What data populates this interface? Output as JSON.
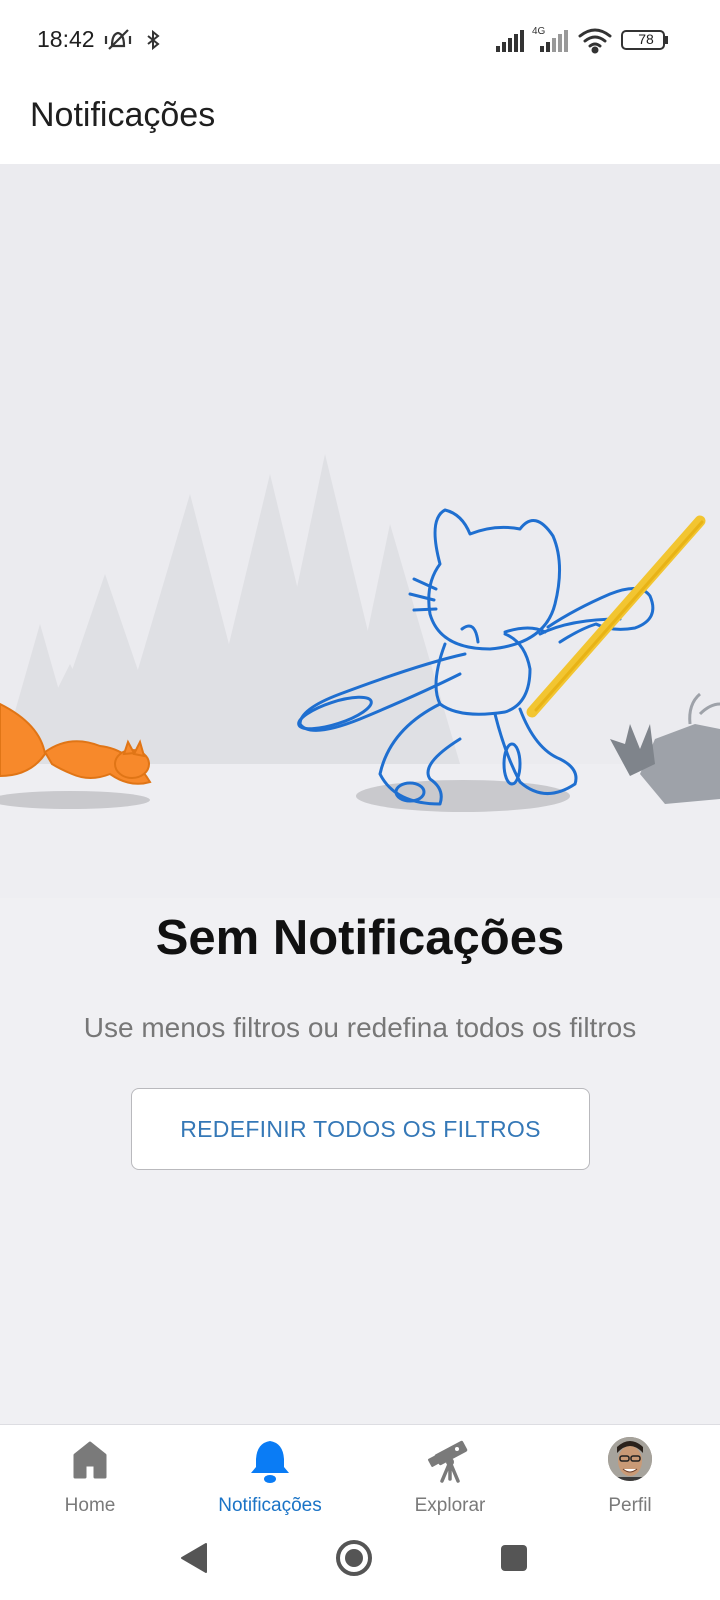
{
  "status_bar": {
    "time": "18:42",
    "battery": "78",
    "network": "4G"
  },
  "header": {
    "title": "Notificações"
  },
  "empty_state": {
    "title": "Sem Notificações",
    "subtitle": "Use menos filtros ou redefina todos os filtros",
    "reset_button_label": "REDEFINIR TODOS OS FILTROS"
  },
  "bottom_nav": {
    "items": [
      {
        "label": "Home",
        "icon": "home-icon",
        "active": false
      },
      {
        "label": "Notificações",
        "icon": "bell-icon",
        "active": true
      },
      {
        "label": "Explorar",
        "icon": "telescope-icon",
        "active": false
      },
      {
        "label": "Perfil",
        "icon": "avatar",
        "active": false
      }
    ]
  },
  "colors": {
    "accent": "#1a73c6",
    "bell_active": "#0a7cf5",
    "button_text": "#3578b7",
    "illustration_line": "#1f6fd0",
    "squirrel": "#f7892b",
    "wand": "#f2c531"
  }
}
